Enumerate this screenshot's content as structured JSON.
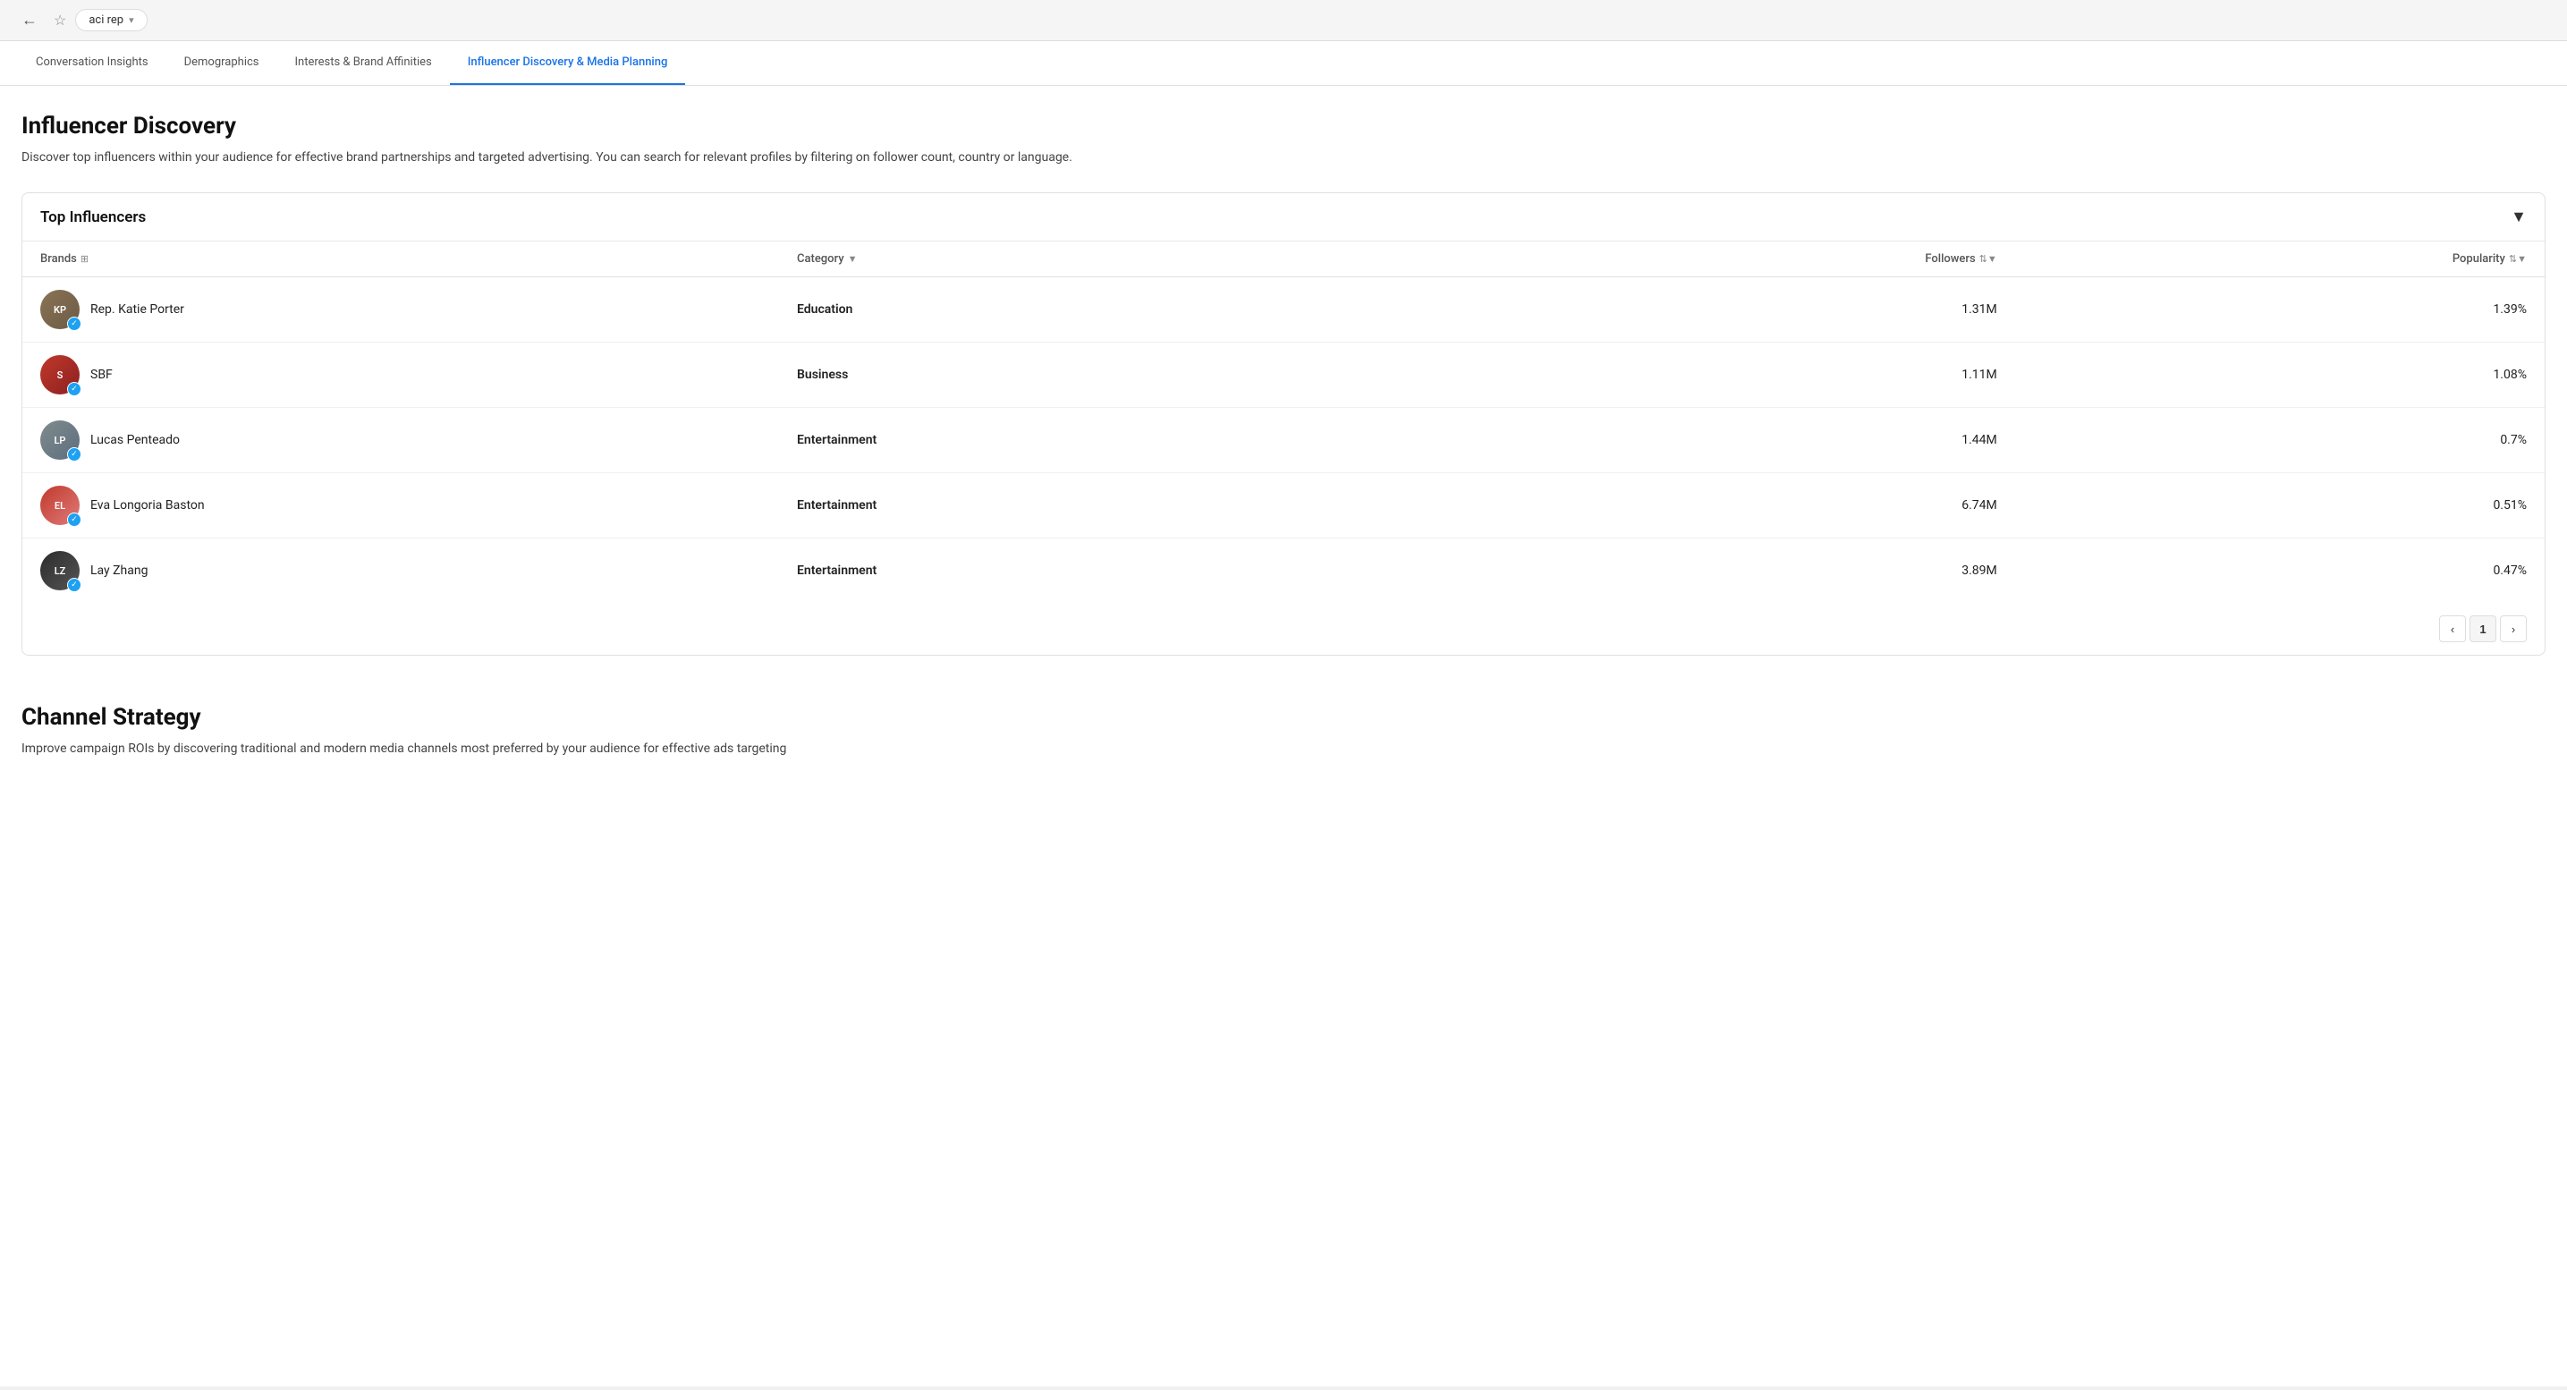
{
  "browser": {
    "back_label": "←",
    "star_label": "☆",
    "tab_name": "aci rep",
    "chevron": "▾"
  },
  "nav": {
    "tabs": [
      {
        "id": "conversation",
        "label": "Conversation Insights",
        "active": false
      },
      {
        "id": "demographics",
        "label": "Demographics",
        "active": false
      },
      {
        "id": "interests",
        "label": "Interests & Brand Affinities",
        "active": false
      },
      {
        "id": "influencer",
        "label": "Influencer Discovery & Media Planning",
        "active": true
      }
    ]
  },
  "influencer_section": {
    "title": "Influencer Discovery",
    "description": "Discover top influencers within your audience for effective brand partnerships and targeted advertising. You can search for relevant profiles by filtering on follower count, country or language."
  },
  "top_influencers": {
    "card_title": "Top Influencers",
    "filter_icon": "▼",
    "columns": {
      "brands": "Brands",
      "category": "Category",
      "followers": "Followers",
      "popularity": "Popularity"
    },
    "rows": [
      {
        "id": "katie-porter",
        "name": "Rep. Katie Porter",
        "avatar_label": "KP",
        "avatar_class": "avatar-katie",
        "has_twitter": true,
        "category": "Education",
        "followers": "1.31M",
        "popularity": "1.39%"
      },
      {
        "id": "sbf",
        "name": "SBF",
        "avatar_label": "S",
        "avatar_class": "avatar-sbf",
        "has_twitter": true,
        "category": "Business",
        "followers": "1.11M",
        "popularity": "1.08%"
      },
      {
        "id": "lucas-penteado",
        "name": "Lucas Penteado",
        "avatar_label": "LP",
        "avatar_class": "avatar-lucas",
        "has_twitter": true,
        "category": "Entertainment",
        "followers": "1.44M",
        "popularity": "0.7%"
      },
      {
        "id": "eva-longoria",
        "name": "Eva Longoria Baston",
        "avatar_label": "EL",
        "avatar_class": "avatar-eva",
        "has_twitter": true,
        "category": "Entertainment",
        "followers": "6.74M",
        "popularity": "0.51%"
      },
      {
        "id": "lay-zhang",
        "name": "Lay Zhang",
        "avatar_label": "LZ",
        "avatar_class": "avatar-lay",
        "has_twitter": true,
        "category": "Entertainment",
        "followers": "3.89M",
        "popularity": "0.47%"
      }
    ],
    "pagination": {
      "prev": "‹",
      "current": "1",
      "next": "›"
    }
  },
  "channel_strategy": {
    "title": "Channel Strategy",
    "description": "Improve campaign ROIs by discovering traditional and modern media channels most preferred by your audience for effective ads targeting"
  }
}
